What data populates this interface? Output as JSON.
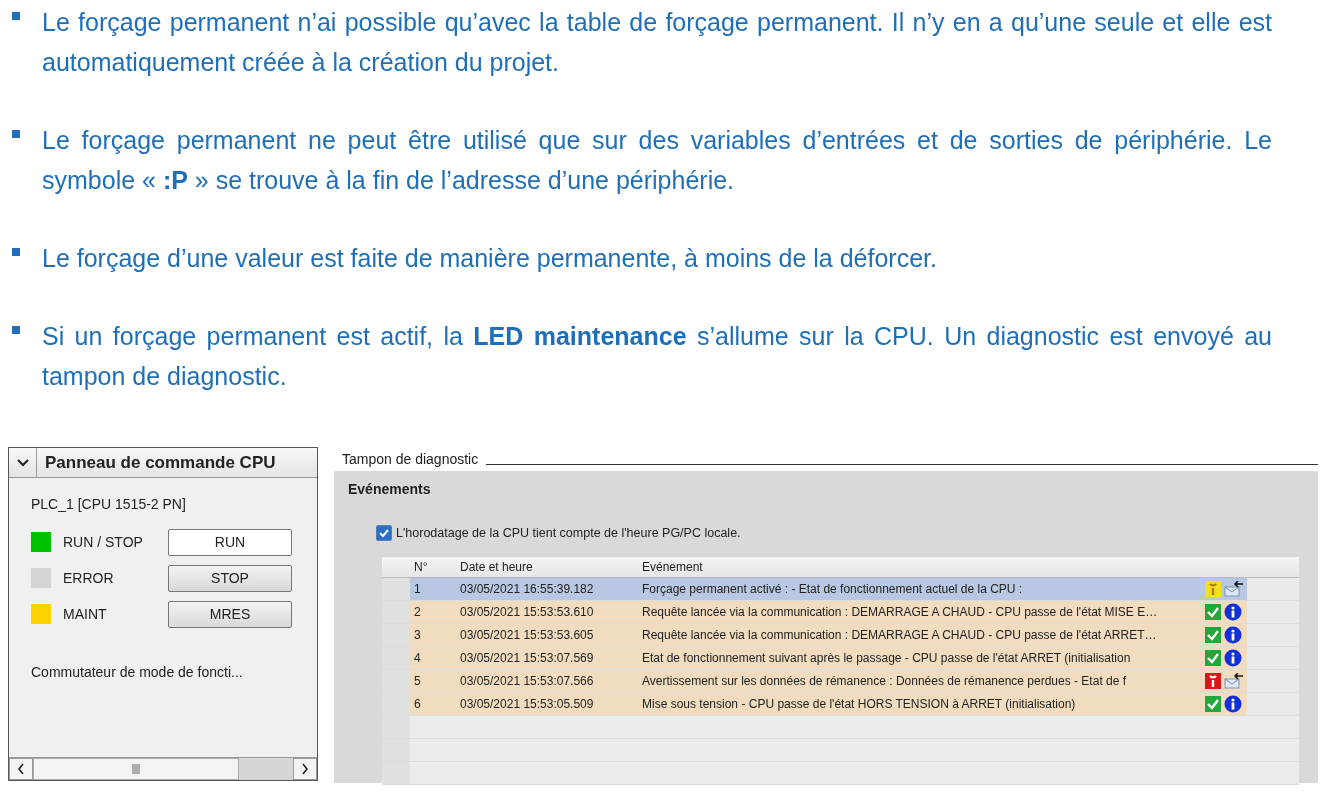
{
  "bullets": [
    "Le forçage permanent n’ai possible qu’avec la table de forçage permanent. Il n’y en a qu’une seule et elle est automatiquement créée à la création du projet.",
    "Le forçage permanent ne peut être utilisé que sur des variables d’entrées et de sorties de périphérie. Le symbole « **:P** » se trouve à la fin de l’adresse d’une périphérie.",
    "Le forçage d’une valeur est faite de manière permanente, à moins de la déforcer.",
    "Si un forçage permanent est actif, la **LED maintenance** s’allume sur la CPU. Un diagnostic est envoyé au tampon de diagnostic."
  ],
  "cpu_panel": {
    "title": "Panneau de commande CPU",
    "expanded": true,
    "device": "PLC_1 [CPU 1515-2 PN]",
    "leds": [
      {
        "label": "RUN / STOP",
        "color": "#00c000"
      },
      {
        "label": "ERROR",
        "color": "#d4d4d4"
      },
      {
        "label": "MAINT",
        "color": "#ffd200"
      }
    ],
    "buttons": [
      {
        "label": "RUN",
        "selected": true
      },
      {
        "label": "STOP",
        "selected": false
      },
      {
        "label": "MRES",
        "selected": false
      }
    ],
    "mode_switch": "Commutateur de mode de foncti..."
  },
  "diagnostic": {
    "title": "Tampon de diagnostic",
    "section": "Evénements",
    "checkbox": {
      "label": "L'horodatage de la CPU tient compte de l'heure PG/PC locale.",
      "checked": true
    },
    "columns": [
      "N°",
      "Date et heure",
      "Evénement"
    ],
    "rows": [
      {
        "n": "1",
        "date": "03/05/2021 16:55:39.182",
        "event": "Forçage permanent activé :   - Etat de fonctionnement actuel de la CPU :",
        "kind": "maintenance",
        "selected": true
      },
      {
        "n": "2",
        "date": "03/05/2021 15:53:53.610",
        "event": "Requête lancée via la communication : DEMARRAGE A CHAUD  - CPU passe de l'état MISE E…",
        "kind": "ok",
        "selected": false
      },
      {
        "n": "3",
        "date": "03/05/2021 15:53:53.605",
        "event": "Requête lancée via la communication : DEMARRAGE A CHAUD  - CPU passe de l'état ARRET…",
        "kind": "ok",
        "selected": false
      },
      {
        "n": "4",
        "date": "03/05/2021 15:53:07.569",
        "event": "Etat de fonctionnement suivant après le passage  - CPU passe de l'état ARRET (initialisation",
        "kind": "ok",
        "selected": false
      },
      {
        "n": "5",
        "date": "03/05/2021 15:53:07.566",
        "event": "Avertissement sur les données de rémanence : Données de rémanence perdues - Etat de f",
        "kind": "error",
        "selected": false
      },
      {
        "n": "6",
        "date": "03/05/2021 15:53:05.509",
        "event": "Mise sous tension  - CPU passe de l'état HORS TENSION à ARRET (initialisation)",
        "kind": "ok",
        "selected": false
      }
    ]
  }
}
